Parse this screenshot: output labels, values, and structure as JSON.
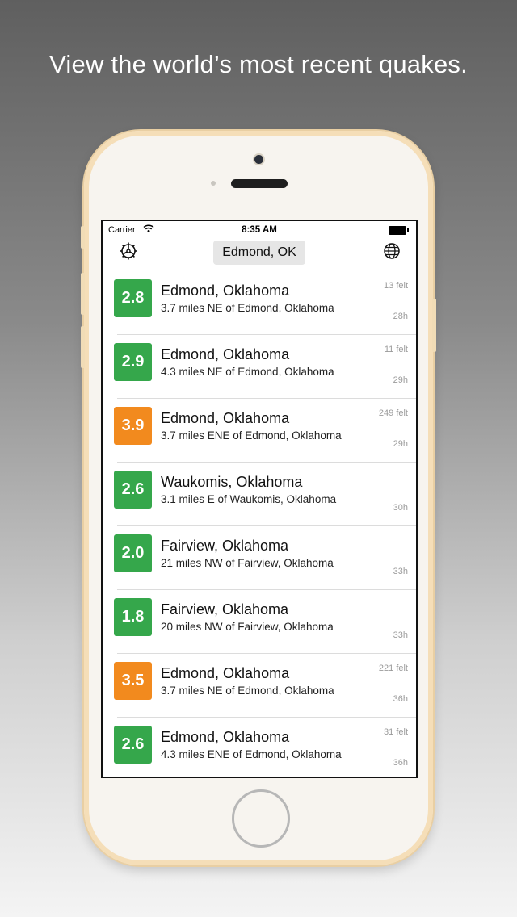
{
  "headline": "View the world’s most recent quakes.",
  "status_bar": {
    "carrier": "Carrier",
    "time": "8:35 AM"
  },
  "nav": {
    "location_label": "Edmond, OK"
  },
  "colors": {
    "green": "#35a74b",
    "orange": "#f28a1e"
  },
  "quakes": [
    {
      "mag": "2.8",
      "color": "green",
      "title": "Edmond, Oklahoma",
      "detail": "3.7 miles NE of Edmond, Oklahoma",
      "felt": "13 felt",
      "age": "28h"
    },
    {
      "mag": "2.9",
      "color": "green",
      "title": "Edmond, Oklahoma",
      "detail": "4.3 miles NE of Edmond, Oklahoma",
      "felt": "11 felt",
      "age": "29h"
    },
    {
      "mag": "3.9",
      "color": "orange",
      "title": "Edmond, Oklahoma",
      "detail": "3.7 miles ENE of Edmond, Oklahoma",
      "felt": "249 felt",
      "age": "29h"
    },
    {
      "mag": "2.6",
      "color": "green",
      "title": "Waukomis, Oklahoma",
      "detail": "3.1 miles E of Waukomis, Oklahoma",
      "felt": "",
      "age": "30h"
    },
    {
      "mag": "2.0",
      "color": "green",
      "title": "Fairview, Oklahoma",
      "detail": "21 miles NW of Fairview, Oklahoma",
      "felt": "",
      "age": "33h"
    },
    {
      "mag": "1.8",
      "color": "green",
      "title": "Fairview, Oklahoma",
      "detail": "20 miles NW of Fairview, Oklahoma",
      "felt": "",
      "age": "33h"
    },
    {
      "mag": "3.5",
      "color": "orange",
      "title": "Edmond, Oklahoma",
      "detail": "3.7 miles NE of Edmond, Oklahoma",
      "felt": "221 felt",
      "age": "36h"
    },
    {
      "mag": "2.6",
      "color": "green",
      "title": "Edmond, Oklahoma",
      "detail": "4.3 miles ENE of Edmond, Oklahoma",
      "felt": "31 felt",
      "age": "36h"
    }
  ]
}
